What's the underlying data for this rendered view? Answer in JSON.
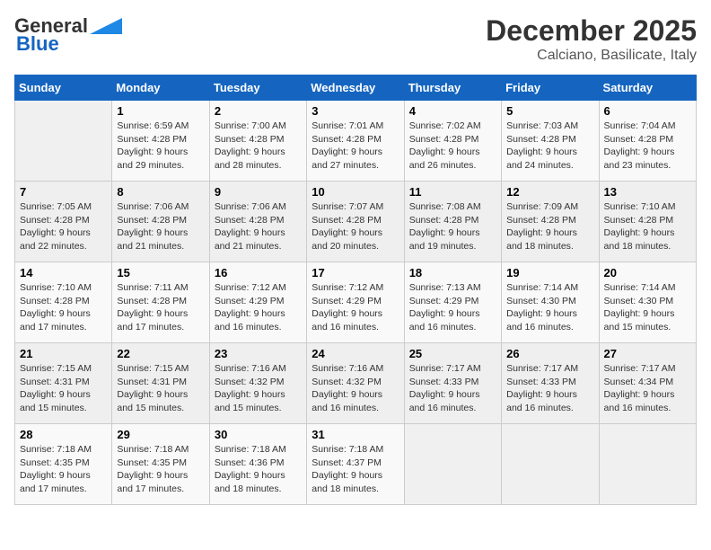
{
  "header": {
    "logo_line1": "General",
    "logo_line2": "Blue",
    "month_title": "December 2025",
    "subtitle": "Calciano, Basilicate, Italy"
  },
  "days_of_week": [
    "Sunday",
    "Monday",
    "Tuesday",
    "Wednesday",
    "Thursday",
    "Friday",
    "Saturday"
  ],
  "weeks": [
    [
      {
        "day": "",
        "info": ""
      },
      {
        "day": "1",
        "info": "Sunrise: 6:59 AM\nSunset: 4:28 PM\nDaylight: 9 hours\nand 29 minutes."
      },
      {
        "day": "2",
        "info": "Sunrise: 7:00 AM\nSunset: 4:28 PM\nDaylight: 9 hours\nand 28 minutes."
      },
      {
        "day": "3",
        "info": "Sunrise: 7:01 AM\nSunset: 4:28 PM\nDaylight: 9 hours\nand 27 minutes."
      },
      {
        "day": "4",
        "info": "Sunrise: 7:02 AM\nSunset: 4:28 PM\nDaylight: 9 hours\nand 26 minutes."
      },
      {
        "day": "5",
        "info": "Sunrise: 7:03 AM\nSunset: 4:28 PM\nDaylight: 9 hours\nand 24 minutes."
      },
      {
        "day": "6",
        "info": "Sunrise: 7:04 AM\nSunset: 4:28 PM\nDaylight: 9 hours\nand 23 minutes."
      }
    ],
    [
      {
        "day": "7",
        "info": "Sunrise: 7:05 AM\nSunset: 4:28 PM\nDaylight: 9 hours\nand 22 minutes."
      },
      {
        "day": "8",
        "info": "Sunrise: 7:06 AM\nSunset: 4:28 PM\nDaylight: 9 hours\nand 21 minutes."
      },
      {
        "day": "9",
        "info": "Sunrise: 7:06 AM\nSunset: 4:28 PM\nDaylight: 9 hours\nand 21 minutes."
      },
      {
        "day": "10",
        "info": "Sunrise: 7:07 AM\nSunset: 4:28 PM\nDaylight: 9 hours\nand 20 minutes."
      },
      {
        "day": "11",
        "info": "Sunrise: 7:08 AM\nSunset: 4:28 PM\nDaylight: 9 hours\nand 19 minutes."
      },
      {
        "day": "12",
        "info": "Sunrise: 7:09 AM\nSunset: 4:28 PM\nDaylight: 9 hours\nand 18 minutes."
      },
      {
        "day": "13",
        "info": "Sunrise: 7:10 AM\nSunset: 4:28 PM\nDaylight: 9 hours\nand 18 minutes."
      }
    ],
    [
      {
        "day": "14",
        "info": "Sunrise: 7:10 AM\nSunset: 4:28 PM\nDaylight: 9 hours\nand 17 minutes."
      },
      {
        "day": "15",
        "info": "Sunrise: 7:11 AM\nSunset: 4:28 PM\nDaylight: 9 hours\nand 17 minutes."
      },
      {
        "day": "16",
        "info": "Sunrise: 7:12 AM\nSunset: 4:29 PM\nDaylight: 9 hours\nand 16 minutes."
      },
      {
        "day": "17",
        "info": "Sunrise: 7:12 AM\nSunset: 4:29 PM\nDaylight: 9 hours\nand 16 minutes."
      },
      {
        "day": "18",
        "info": "Sunrise: 7:13 AM\nSunset: 4:29 PM\nDaylight: 9 hours\nand 16 minutes."
      },
      {
        "day": "19",
        "info": "Sunrise: 7:14 AM\nSunset: 4:30 PM\nDaylight: 9 hours\nand 16 minutes."
      },
      {
        "day": "20",
        "info": "Sunrise: 7:14 AM\nSunset: 4:30 PM\nDaylight: 9 hours\nand 15 minutes."
      }
    ],
    [
      {
        "day": "21",
        "info": "Sunrise: 7:15 AM\nSunset: 4:31 PM\nDaylight: 9 hours\nand 15 minutes."
      },
      {
        "day": "22",
        "info": "Sunrise: 7:15 AM\nSunset: 4:31 PM\nDaylight: 9 hours\nand 15 minutes."
      },
      {
        "day": "23",
        "info": "Sunrise: 7:16 AM\nSunset: 4:32 PM\nDaylight: 9 hours\nand 15 minutes."
      },
      {
        "day": "24",
        "info": "Sunrise: 7:16 AM\nSunset: 4:32 PM\nDaylight: 9 hours\nand 16 minutes."
      },
      {
        "day": "25",
        "info": "Sunrise: 7:17 AM\nSunset: 4:33 PM\nDaylight: 9 hours\nand 16 minutes."
      },
      {
        "day": "26",
        "info": "Sunrise: 7:17 AM\nSunset: 4:33 PM\nDaylight: 9 hours\nand 16 minutes."
      },
      {
        "day": "27",
        "info": "Sunrise: 7:17 AM\nSunset: 4:34 PM\nDaylight: 9 hours\nand 16 minutes."
      }
    ],
    [
      {
        "day": "28",
        "info": "Sunrise: 7:18 AM\nSunset: 4:35 PM\nDaylight: 9 hours\nand 17 minutes."
      },
      {
        "day": "29",
        "info": "Sunrise: 7:18 AM\nSunset: 4:35 PM\nDaylight: 9 hours\nand 17 minutes."
      },
      {
        "day": "30",
        "info": "Sunrise: 7:18 AM\nSunset: 4:36 PM\nDaylight: 9 hours\nand 18 minutes."
      },
      {
        "day": "31",
        "info": "Sunrise: 7:18 AM\nSunset: 4:37 PM\nDaylight: 9 hours\nand 18 minutes."
      },
      {
        "day": "",
        "info": ""
      },
      {
        "day": "",
        "info": ""
      },
      {
        "day": "",
        "info": ""
      }
    ]
  ]
}
